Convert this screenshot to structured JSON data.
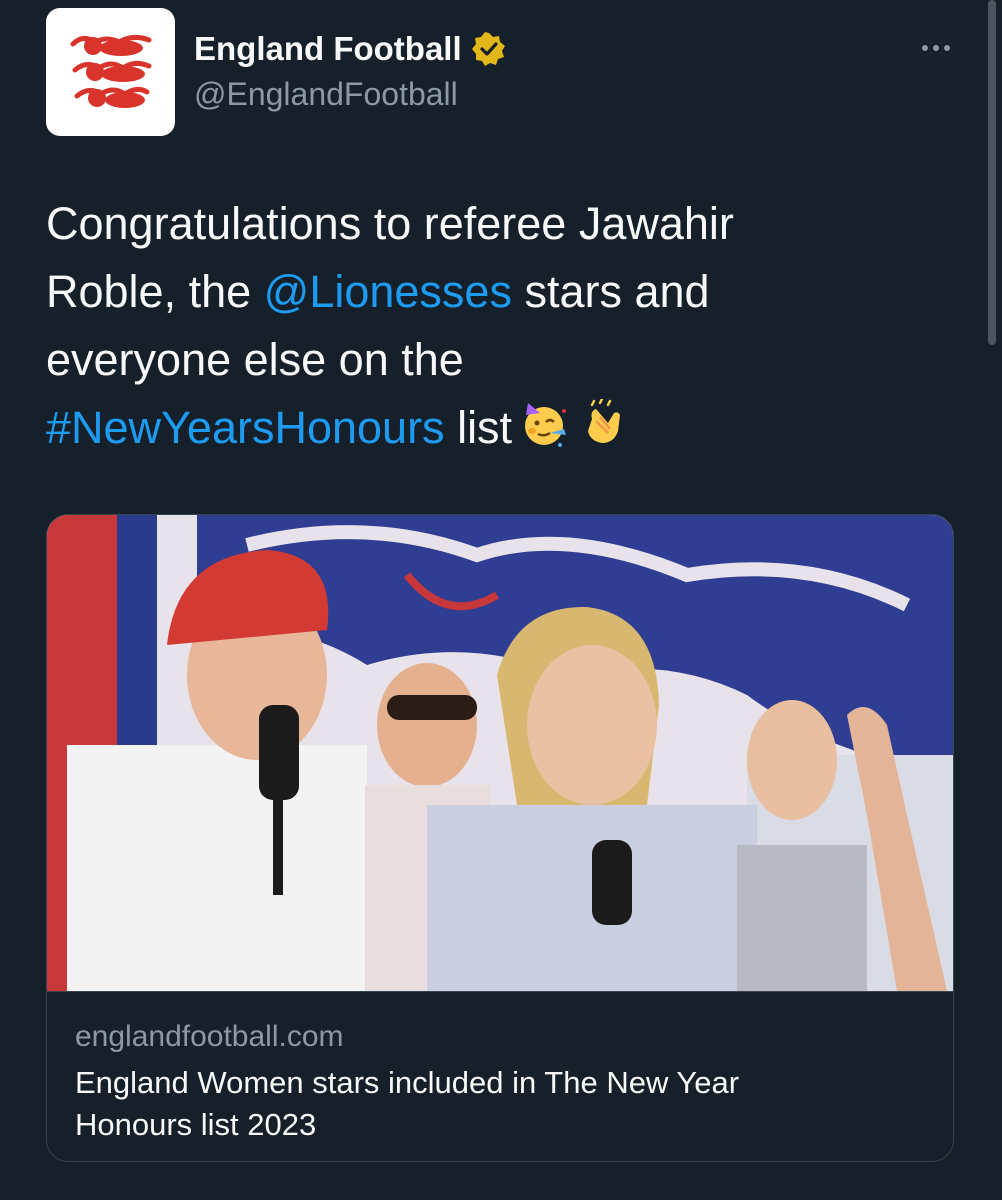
{
  "author": {
    "display_name": "England Football",
    "handle": "@EnglandFootball",
    "verified": true,
    "avatar_icon": "three-lions-crest-icon"
  },
  "menu": {
    "icon": "more-options-icon"
  },
  "tweet": {
    "line1": "Congratulations to referee Jawahir",
    "line2_before": "Roble, the ",
    "mention": "@Lionesses",
    "line2_after": " stars and",
    "line3": "everyone else on the",
    "hashtag": "#NewYearsHonours",
    "line4_after": " list",
    "emojis": [
      "partying-face-icon",
      "clapping-hands-icon"
    ]
  },
  "card": {
    "image": "england-women-players-on-stage-photo",
    "domain": "englandfootball.com",
    "title_line1": "England Women stars included in The New Year",
    "title_line2": "Honours list 2023"
  },
  "colors": {
    "background": "#15202b",
    "text": "#f7f9f9",
    "secondary": "#8b98a5",
    "link": "#1d9bf0",
    "verified_badge": "#e2b719",
    "crest_red": "#d9342b"
  }
}
